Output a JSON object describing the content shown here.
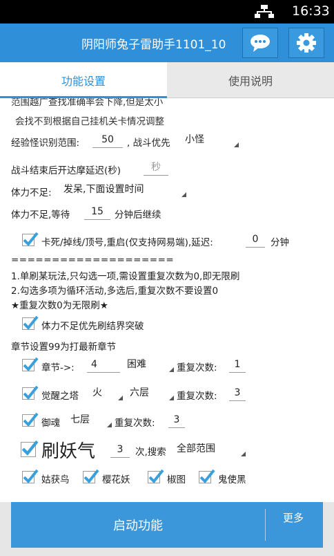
{
  "status_bar": {
    "time": "16:33"
  },
  "header": {
    "title": "阴阳师兔子雷助手1101_10"
  },
  "tabs": [
    {
      "label": "功能设置"
    },
    {
      "label": "使用说明"
    }
  ],
  "settings": {
    "notes": [
      "范围越广查找准确率会下降,但是太小",
      "会找不到根据自己挂机关卡情况调整"
    ],
    "exp_monster_range_label": "经验怪识别范围:",
    "exp_monster_range_value": "50",
    "battle_priority_label": ", 战斗优先",
    "battle_priority_value": "小怪",
    "daruma_delay_label": "战斗结束后开达摩延迟(秒)",
    "daruma_delay_placeholder": "秒",
    "stamina_low_label": "体力不足:",
    "stamina_low_value": "发呆,下面设置时间",
    "stamina_wait_label": "体力不足,等待",
    "stamina_wait_value": "15",
    "stamina_wait_suffix": "分钟后继续",
    "restart_label": "卡死/掉线/顶号,重启(仅支持网易端),延迟:",
    "restart_value": "0",
    "restart_suffix": "分钟",
    "separator": "====================",
    "instructions": [
      "1.单刷某玩法,只勾选一项,需设置重复次数为0,即无限刷",
      "2.勾选多项为循环活动,多选后,重复次数不要设置0",
      "★重复次数0为无限刷★"
    ],
    "stamina_barrier_label": "体力不足优先刷结界突破",
    "chapter_hint": "章节设置99为打最新章节",
    "chapter_label": "章节->:",
    "chapter_value": "4",
    "chapter_difficulty": "困难",
    "repeat_label": "重复次数:",
    "chapter_repeat": "1",
    "tower_label": "觉醒之塔",
    "tower_element": "火",
    "tower_floor": "六层",
    "tower_repeat": "3",
    "soul_label": "御魂",
    "soul_floor": "七层",
    "soul_repeat": "3",
    "demon_label": "刷妖气",
    "demon_count": "3",
    "demon_suffix": "次,搜索",
    "demon_search": "全部范围",
    "shikigami": [
      "姑获鸟",
      "樱花妖",
      "椒图",
      "鬼使黑"
    ]
  },
  "footer": {
    "start_label": "启动功能",
    "more_label": "更多"
  },
  "colors": {
    "accent": "#2f8fd8",
    "check": "#3aa0dc"
  }
}
